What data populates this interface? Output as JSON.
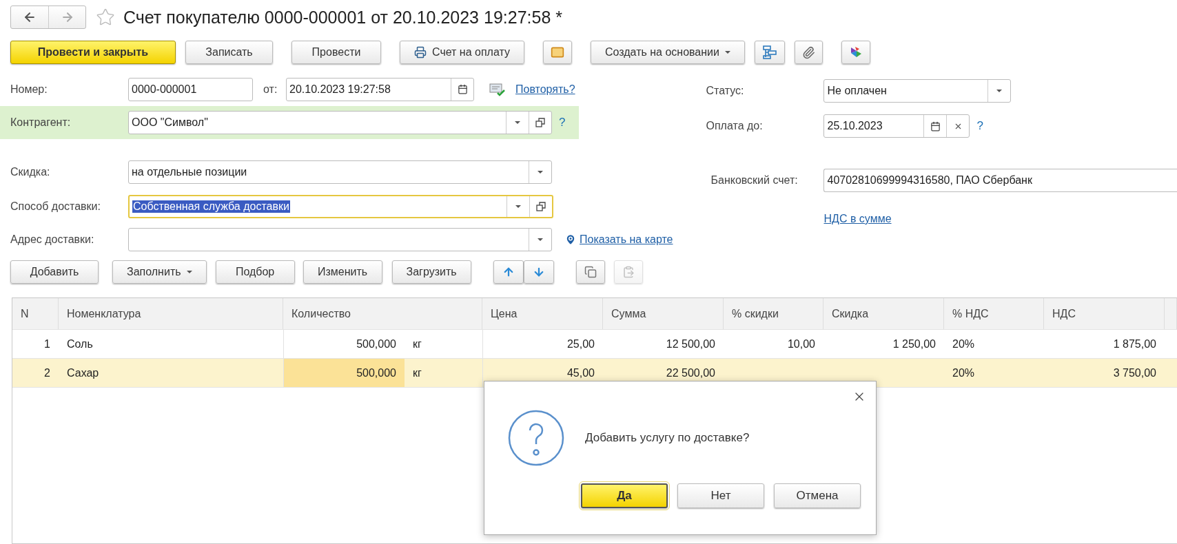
{
  "window": {
    "title": "Счет покупателю 0000-000001 от 20.10.2023 19:27:58 *",
    "favorite": false
  },
  "toolbar": [
    {
      "kind": "primary",
      "label": "Провести и закрыть"
    },
    {
      "kind": "text",
      "label": "Записать"
    },
    {
      "kind": "text",
      "label": "Провести"
    },
    {
      "kind": "icon_text",
      "label": "Счет на оплату"
    },
    {
      "kind": "icon"
    },
    {
      "kind": "menu",
      "label": "Создать на основании"
    },
    {
      "kind": "icon"
    },
    {
      "kind": "icon"
    },
    {
      "kind": "icon"
    }
  ],
  "number": {
    "label": "Номер:",
    "value": "0000-000001"
  },
  "date": {
    "label": "от:",
    "value": "20.10.2023 19:27:58"
  },
  "repeat_link": "Повторять?",
  "status": {
    "label": "Статус:",
    "value": "Не оплачен"
  },
  "payment_due": {
    "label": "Оплата до:",
    "value": "25.10.2023",
    "help": "?"
  },
  "counterparty": {
    "label": "Контрагент:",
    "value": "ООО \"Символ\"",
    "highlighted": true,
    "help": "?"
  },
  "discount": {
    "label": "Скидка:",
    "value": "на отдельные позиции"
  },
  "bank_account": {
    "label": "Банковский счет:",
    "value": "40702810699994316580, ПАО Сбербанк"
  },
  "delivery_method": {
    "label": "Способ доставки:",
    "value": "Собственная служба доставки",
    "focused": true
  },
  "vat_link": "НДС в сумме",
  "delivery_address": {
    "label": "Адрес доставки:",
    "map_link": "Показать на карте"
  },
  "table_toolbar": [
    {
      "kind": "text",
      "label": "Добавить",
      "disabled": false
    },
    {
      "kind": "menu",
      "label": "Заполнить",
      "disabled": false
    },
    {
      "kind": "text",
      "label": "Подбор",
      "disabled": false
    },
    {
      "kind": "text",
      "label": "Изменить",
      "disabled": false
    },
    {
      "kind": "text",
      "label": "Загрузить",
      "disabled": false
    },
    {
      "kind": "arrows",
      "disabled": false
    },
    {
      "kind": "icon",
      "disabled": false
    },
    {
      "kind": "icon",
      "disabled": true
    }
  ],
  "table": {
    "columns": [
      "N",
      "Номенклатура",
      "Количество",
      "Цена",
      "Сумма",
      "% скидки",
      "Скидка",
      "% НДС",
      "НДС"
    ],
    "rows": [
      {
        "n": "1",
        "item": "Соль",
        "quantity": "500,000",
        "unit": "кг",
        "price": "25,00",
        "sum": "12 500,00",
        "discount_pct": "10,00",
        "discount": "1 250,00",
        "vat_pct": "20%",
        "vat": "1 875,00",
        "selected": false,
        "current_cell": false
      },
      {
        "n": "2",
        "item": "Сахар",
        "quantity": "500,000",
        "unit": "кг",
        "price": "45,00",
        "sum": "22 500,00",
        "vat_pct": "20%",
        "vat": "3 750,00",
        "selected": true,
        "current_cell": true
      }
    ]
  },
  "dialog": {
    "message": "Добавить услугу по доставке?",
    "buttons": [
      {
        "label": "Да",
        "default": true
      },
      {
        "label": "Нет",
        "default": false
      },
      {
        "label": "Отмена",
        "default": false
      }
    ]
  }
}
